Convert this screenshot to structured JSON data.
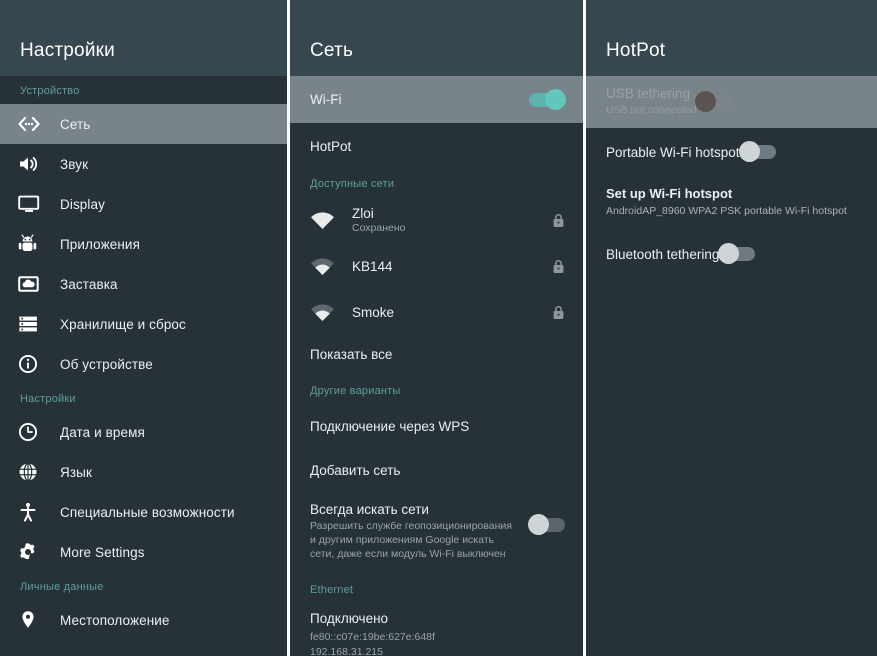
{
  "colors": {
    "panel_bg": "#263238",
    "header_bg": "#37474f",
    "highlight_row": "#78838a",
    "accent_teal": "#5e9e9c",
    "toggle_on": "#61c6bd",
    "text_primary": "#eceff1",
    "text_secondary": "#9aa4a9",
    "divider": "#fbfbfb"
  },
  "sidebar": {
    "title": "Настройки",
    "sections": [
      {
        "header": "Устройство",
        "items": [
          {
            "label": "Сеть",
            "icon": "network-icon",
            "selected": true
          },
          {
            "label": "Звук",
            "icon": "volume-icon",
            "selected": false
          },
          {
            "label": "Display",
            "icon": "display-icon",
            "selected": false
          },
          {
            "label": "Приложения",
            "icon": "android-icon",
            "selected": false
          },
          {
            "label": "Заставка",
            "icon": "daydream-icon",
            "selected": false
          },
          {
            "label": "Хранилище и сброс",
            "icon": "storage-icon",
            "selected": false
          },
          {
            "label": "Об устройстве",
            "icon": "info-icon",
            "selected": false
          }
        ]
      },
      {
        "header": "Настройки",
        "items": [
          {
            "label": "Дата и время",
            "icon": "clock-icon",
            "selected": false
          },
          {
            "label": "Язык",
            "icon": "globe-icon",
            "selected": false
          },
          {
            "label": "Специальные возможности",
            "icon": "accessibility-icon",
            "selected": false
          },
          {
            "label": "More Settings",
            "icon": "gear-icon",
            "selected": false
          }
        ]
      },
      {
        "header": "Личные данные",
        "items": [
          {
            "label": "Местоположение",
            "icon": "location-pin-icon",
            "selected": false
          }
        ]
      }
    ]
  },
  "network": {
    "title": "Сеть",
    "wifi_row": {
      "label": "Wi-Fi",
      "toggle_state": "on",
      "highlighted": true
    },
    "hotpot_row": {
      "label": "HotPot"
    },
    "available_header": "Доступные сети",
    "networks": [
      {
        "ssid": "Zloi",
        "status": "Сохранено",
        "secured": true,
        "signal": 4
      },
      {
        "ssid": "KB144",
        "status": "",
        "secured": true,
        "signal": 2
      },
      {
        "ssid": "Smoke",
        "status": "",
        "secured": true,
        "signal": 2
      }
    ],
    "show_all_label": "Показать все",
    "other_options_header": "Другие варианты",
    "wps_label": "Подключение через WPS",
    "add_network_label": "Добавить сеть",
    "always_scan": {
      "title": "Всегда искать сети",
      "description": "Разрешить службе геопозиционирования и другим приложениям Google искать сети, даже если модуль Wi-Fi выключен",
      "toggle_state": "off"
    },
    "ethernet_header": "Ethernet",
    "ethernet_status": "Подключено",
    "ethernet_ipv6": "fe80::c07e:19be:627e:648f",
    "ethernet_ipv4": "192.168.31.215"
  },
  "hotpot": {
    "title": "HotPot",
    "rows": [
      {
        "title": "USB tethering",
        "subtitle": "USB not connected",
        "toggle_state": "disabled",
        "highlighted": true,
        "disabled": true
      },
      {
        "title": "Portable Wi-Fi hotspot",
        "subtitle": "",
        "toggle_state": "off",
        "highlighted": false,
        "disabled": false
      }
    ],
    "setup": {
      "title": "Set up Wi-Fi hotspot",
      "subtitle": "AndroidAP_8960 WPA2 PSK portable Wi-Fi hotspot"
    },
    "bluetooth_row": {
      "title": "Bluetooth tethering",
      "toggle_state": "off"
    }
  }
}
